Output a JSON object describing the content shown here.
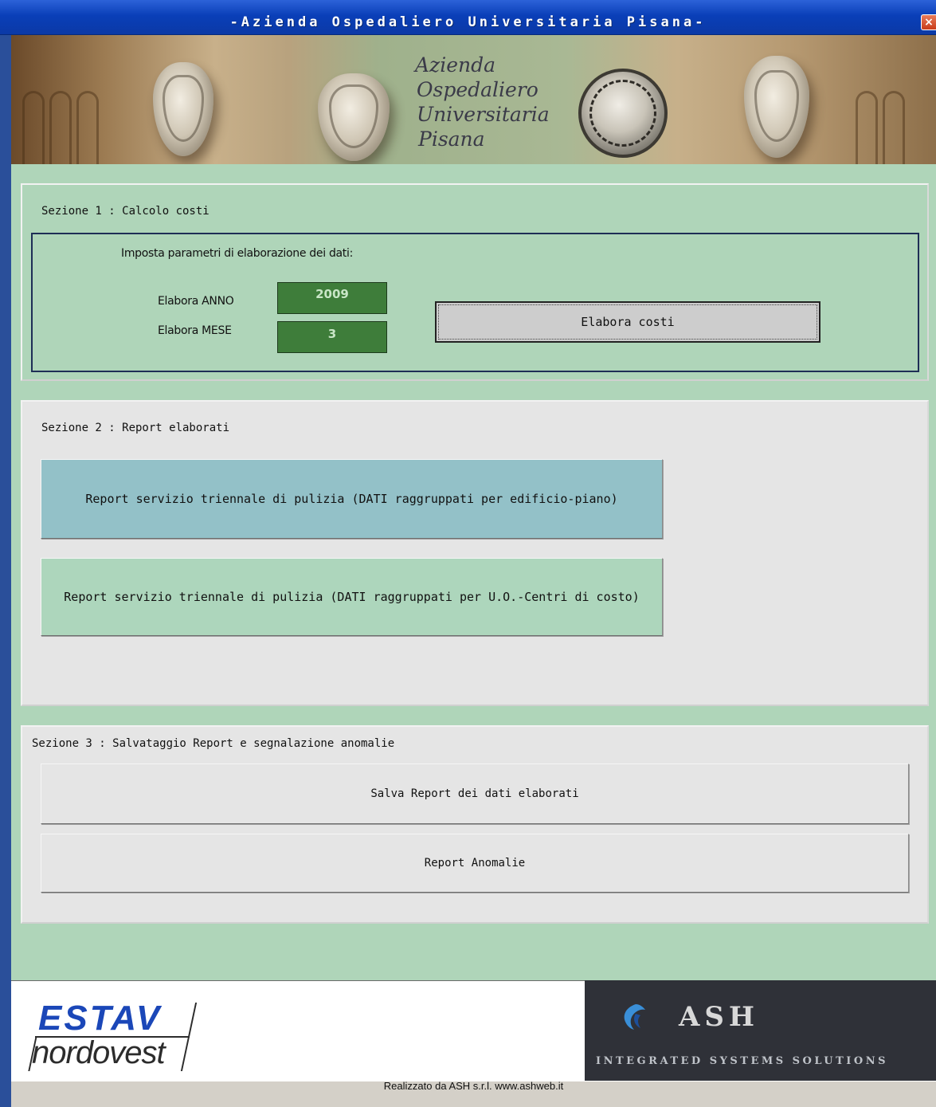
{
  "window": {
    "title": "-Azienda Ospedaliero Universitaria Pisana-",
    "close_glyph": "×"
  },
  "banner": {
    "logo_lines": [
      "Azienda",
      "Ospedaliero",
      "Universitaria",
      "Pisana"
    ]
  },
  "section1": {
    "title": "Sezione 1 : Calcolo costi",
    "params_label": "Imposta parametri di elaborazione dei dati:",
    "anno_label": "Elabora ANNO",
    "anno_value": "2009",
    "mese_label": "Elabora MESE",
    "mese_value": "3",
    "elabora_button": "Elabora costi"
  },
  "section2": {
    "title": "Sezione 2 : Report elaborati",
    "report_edificio_button": "Report servizio triennale di pulizia (DATI raggruppati per edificio-piano)",
    "report_uo_button": "Report servizio triennale di pulizia (DATI raggruppati per  U.O.-Centri di costo)"
  },
  "section3": {
    "title": "Sezione 3 : Salvataggio Report e segnalazione anomalie",
    "salva_button": "Salva Report dei  dati elaborati",
    "anomalie_button": "Report Anomalie"
  },
  "footer": {
    "estav_top": "ESTAV",
    "estav_bottom": "nordovest",
    "ash_name": "ASH",
    "ash_tagline": "INTEGRATED SYSTEMS SOLUTIONS",
    "status_text": "Realizzato da ASH s.r.l.  www.ashweb.it"
  },
  "colors": {
    "panel_green": "#afd5b9",
    "field_green": "#3e7d3a",
    "button_teal": "#93c1c8",
    "estav_blue": "#1b47b8",
    "titlebar_blue": "#0a3fb8"
  }
}
